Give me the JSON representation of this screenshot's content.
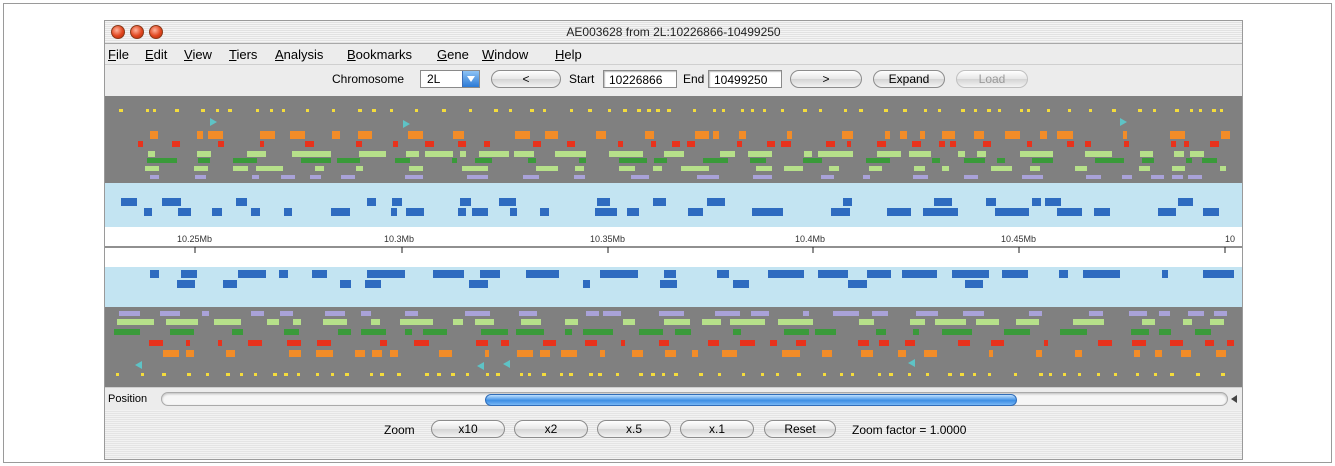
{
  "window": {
    "title": "AE003628 from 2L:10226866-10499250"
  },
  "menu": [
    "File",
    "Edit",
    "View",
    "Tiers",
    "Analysis",
    "Bookmarks",
    "Gene",
    "Window",
    "Help"
  ],
  "toolbar": {
    "chromosome_label": "Chromosome",
    "chromosome_value": "2L",
    "prev_label": "<",
    "start_label": "Start",
    "start_value": "10226866",
    "end_label": "End",
    "end_value": "10499250",
    "next_label": ">",
    "expand_label": "Expand",
    "load_label": "Load"
  },
  "ruler": {
    "ticks": [
      "10.25Mb",
      "10.3Mb",
      "10.35Mb",
      "10.4Mb",
      "10.45Mb",
      "10"
    ]
  },
  "position": {
    "label": "Position",
    "scroll_fraction": 0.5
  },
  "zoom": {
    "label": "Zoom",
    "buttons": [
      "x10",
      "x2",
      "x.5",
      "x.1",
      "Reset"
    ],
    "factor_text": "Zoom factor = 1.0000"
  },
  "colors": {
    "track_bg": "#808080",
    "gene_bg": "#c3e4f2",
    "gene_blue": "#2e6bc0",
    "orange": "#f28c28",
    "red": "#e8321c",
    "yellow": "#f4dc3c",
    "lightgreen": "#b6e08a",
    "green": "#3a9a3a",
    "lavender": "#a9a2d8",
    "cyan": "#5ec3c6"
  }
}
